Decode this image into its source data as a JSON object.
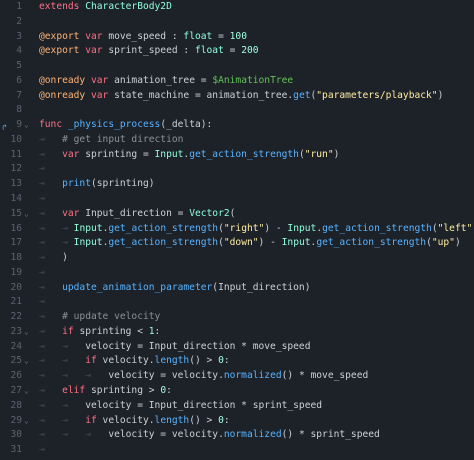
{
  "editor": {
    "line_numbers": [
      "1",
      "2",
      "3",
      "4",
      "5",
      "6",
      "7",
      "8",
      "9",
      "10",
      "11",
      "12",
      "13",
      "14",
      "15",
      "16",
      "17",
      "18",
      "19",
      "20",
      "21",
      "22",
      "23",
      "24",
      "25",
      "26",
      "27",
      "28",
      "29",
      "30",
      "31"
    ],
    "fold_markers": {
      "fold_icon": "chevron-down-icon",
      "indent_icon": "tab-arrow-icon"
    },
    "colors": {
      "background": "#1d2229",
      "keyword": "#ff7085",
      "annotation": "#ffb373",
      "type": "#8effda",
      "number": "#a1ffe0",
      "string": "#ffeda1",
      "function": "#57b3ff",
      "comment": "#8b9099"
    },
    "code": {
      "l1_kw": "extends",
      "l1_cls": "CharacterBody2D",
      "l3_at": "@export",
      "l3_kw": "var",
      "l3_name": "move_speed : ",
      "l3_type": "float",
      "l3_eq": " = ",
      "l3_num": "100",
      "l4_at": "@export",
      "l4_kw": "var",
      "l4_name": "sprint_speed : ",
      "l4_type": "float",
      "l4_eq": " = ",
      "l4_num": "200",
      "l6_at": "@onready",
      "l6_kw": "var",
      "l6_name": "animation_tree = ",
      "l6_node": "$AnimationTree",
      "l7_at": "@onready",
      "l7_kw": "var",
      "l7_name": "state_machine = animation_tree.",
      "l7_fn": "get",
      "l7_open": "(",
      "l7_str": "\"parameters/playback\"",
      "l7_close": ")",
      "l9_kw": "func",
      "l9_fn": "_physics_process",
      "l9_rest": "(_delta):",
      "l10_cmt": "# get input direction",
      "l11_kw": "var",
      "l11_a": "sprinting = ",
      "l11_cls": "Input",
      "l11_dot": ".",
      "l11_fn": "get_action_strength",
      "l11_open": "(",
      "l11_str": "\"run\"",
      "l11_close": ")",
      "l13_fn": "print",
      "l13_rest": "(sprinting)",
      "l15_kw": "var",
      "l15_a": "Input_direction = ",
      "l15_cls": "Vector2",
      "l15_open": "(",
      "l16_cls1": "Input",
      "l16_dot1": ".",
      "l16_fn1": "get_action_strength",
      "l16_o1": "(",
      "l16_s1": "\"right\"",
      "l16_mid": ") - ",
      "l16_cls2": "Input",
      "l16_dot2": ".",
      "l16_fn2": "get_action_strength",
      "l16_o2": "(",
      "l16_s2": "\"left\"",
      "l16_end": "),",
      "l17_cls1": "Input",
      "l17_dot1": ".",
      "l17_fn1": "get_action_strength",
      "l17_o1": "(",
      "l17_s1": "\"down\"",
      "l17_mid": ") - ",
      "l17_cls2": "Input",
      "l17_dot2": ".",
      "l17_fn2": "get_action_strength",
      "l17_o2": "(",
      "l17_s2": "\"up\"",
      "l17_end": ")",
      "l18": ")",
      "l20_fn": "update_animation_parameter",
      "l20_rest": "(Input_direction)",
      "l22_cmt": "# update velocity",
      "l23_kw": "if",
      "l23_a": " sprinting < ",
      "l23_num": "1",
      "l23_end": ":",
      "l24": "velocity = Input_direction * move_speed",
      "l25_kw": "if",
      "l25_a": " velocity.",
      "l25_fn": "length",
      "l25_b": "() > ",
      "l25_num": "0",
      "l25_end": ":",
      "l26_a": "velocity = velocity.",
      "l26_fn": "normalized",
      "l26_b": "() * move_speed",
      "l27_kw": "elif",
      "l27_a": " sprinting > ",
      "l27_num": "0",
      "l27_end": ":",
      "l28": "velocity = Input_direction * sprint_speed",
      "l29_kw": "if",
      "l29_a": " velocity.",
      "l29_fn": "length",
      "l29_b": "() > ",
      "l29_num": "0",
      "l29_end": ":",
      "l30_a": "velocity = velocity.",
      "l30_fn": "normalized",
      "l30_b": "() * sprint_speed"
    }
  }
}
